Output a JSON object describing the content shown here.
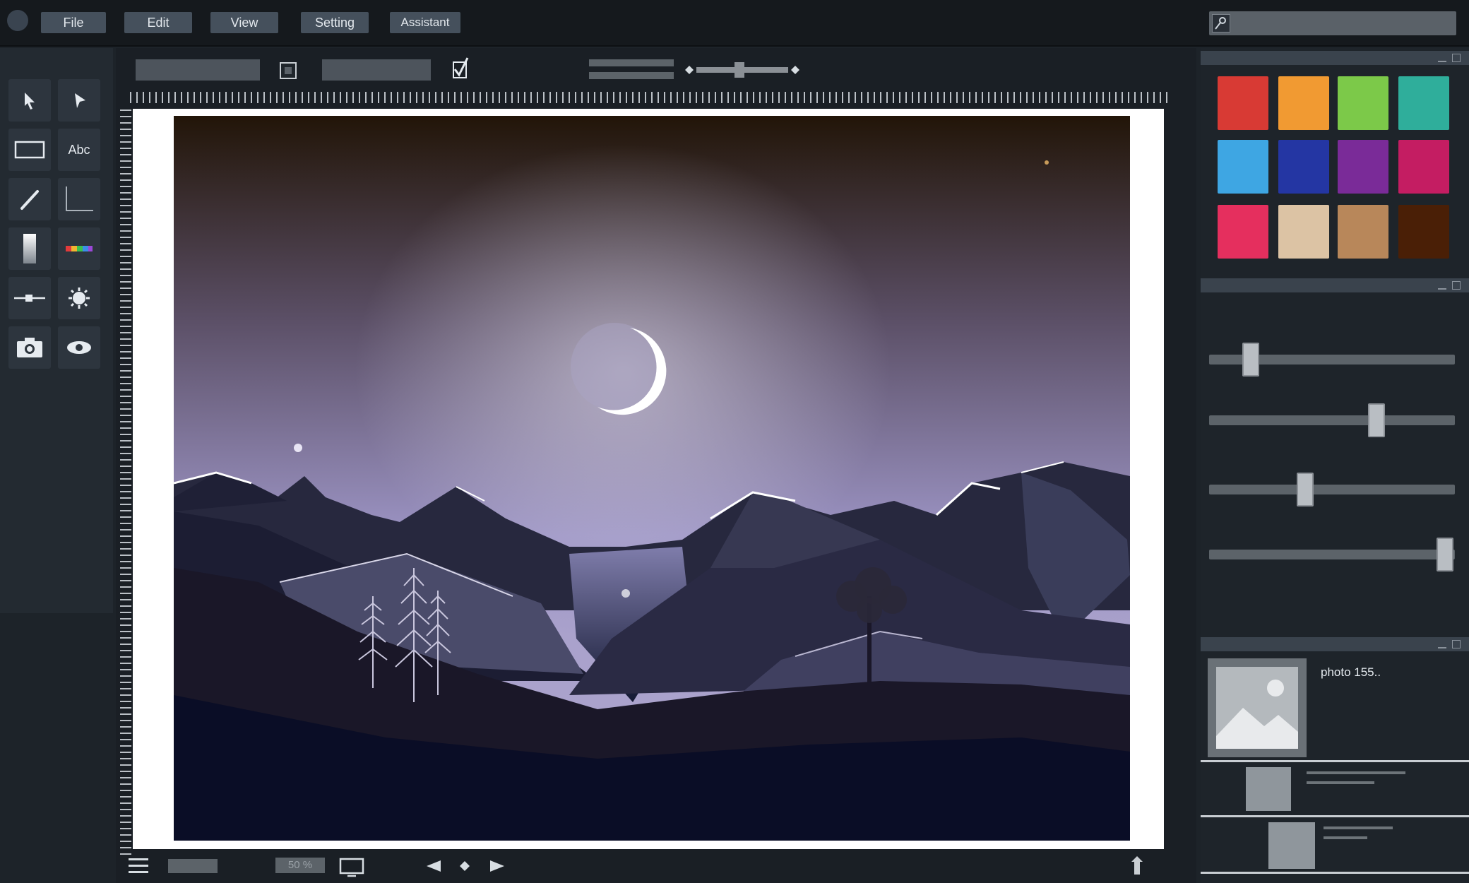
{
  "menu": {
    "items": [
      {
        "key": "file",
        "label": "File"
      },
      {
        "key": "edit",
        "label": "Edit"
      },
      {
        "key": "view",
        "label": "View"
      },
      {
        "key": "setting",
        "label": "Setting"
      },
      {
        "key": "assistant",
        "label": "Assistant"
      }
    ]
  },
  "toolbox": {
    "tools": [
      "selection-arrow",
      "direct-select-arrow",
      "rectangle",
      "text",
      "pen",
      "corner-line",
      "gradient-bar",
      "color-picker",
      "line-tool",
      "sun-effect",
      "camera",
      "eye-preview"
    ],
    "text_tool_label": "Abc"
  },
  "options_bar": {
    "checkbox_checked": true
  },
  "palette": {
    "colors": [
      "#d83a34",
      "#f19a32",
      "#7cc949",
      "#2fae9b",
      "#3ea6e3",
      "#2436a3",
      "#7a2b98",
      "#c41d62",
      "#e52f5e",
      "#dcc3a4",
      "#b8875a",
      "#4a1f06"
    ]
  },
  "adjustments": {
    "sliders": [
      {
        "name": "slider-1",
        "value": 0.17
      },
      {
        "name": "slider-2",
        "value": 0.68
      },
      {
        "name": "slider-3",
        "value": 0.39
      },
      {
        "name": "slider-4",
        "value": 0.96
      }
    ]
  },
  "layers": {
    "items": [
      {
        "name": "photo 155..",
        "thumbnail": "image-placeholder"
      }
    ]
  },
  "statusbar": {
    "zoom": "50 %"
  }
}
